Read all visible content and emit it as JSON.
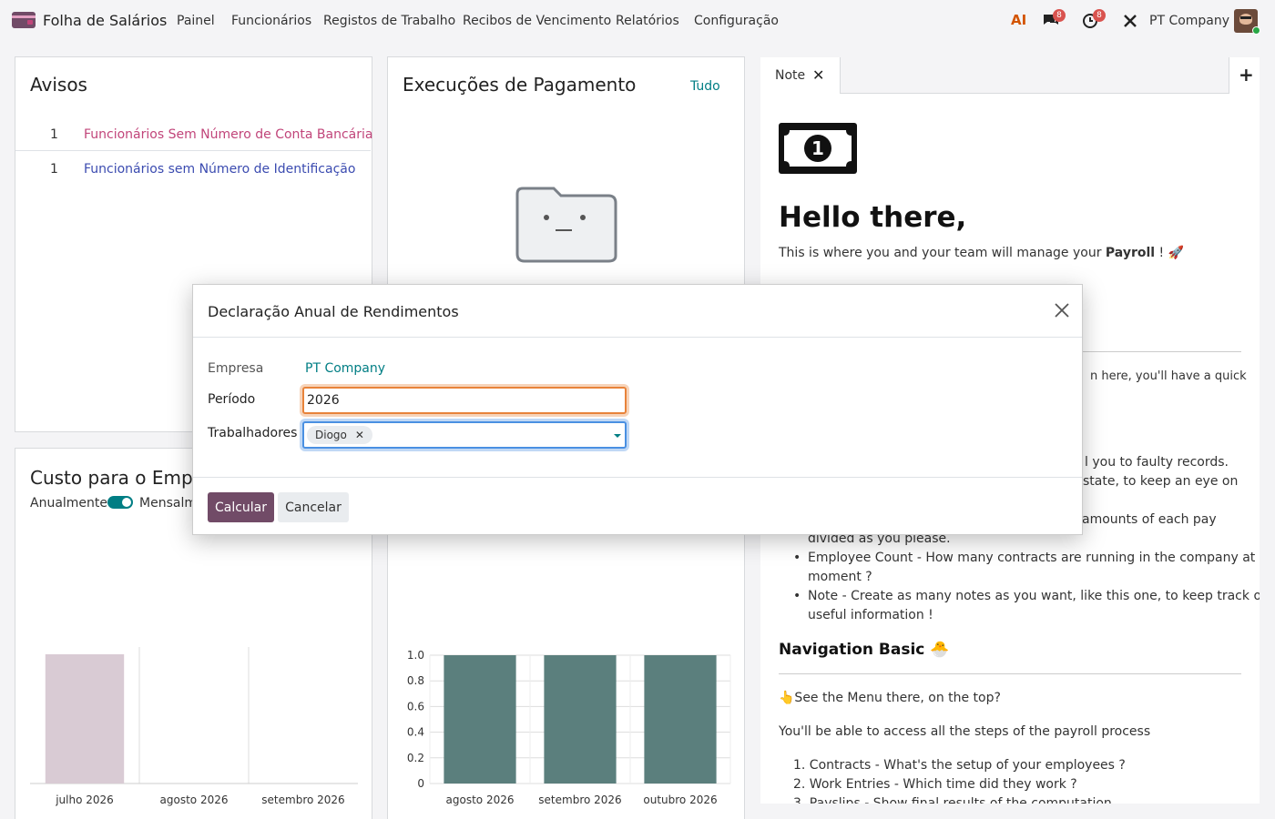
{
  "navbar": {
    "app_name": "Folha de Salários",
    "menu": [
      "Painel",
      "Funcionários",
      "Registos de Trabalho",
      "Recibos de Vencimento",
      "Relatórios",
      "Configuração"
    ],
    "ai_label": "AI",
    "messages_badge": "8",
    "activities_badge": "8",
    "company": "PT Company"
  },
  "warnings": {
    "title": "Avisos",
    "items": [
      {
        "count": "1",
        "label": "Funcionários Sem Número de Conta Bancária",
        "color": "#c1457a"
      },
      {
        "count": "1",
        "label": "Funcionários sem Número de Identificação",
        "color": "#3b4bb0"
      }
    ]
  },
  "payruns": {
    "title": "Execuções de Pagamento",
    "all_link": "Tudo"
  },
  "cost": {
    "title": "Custo para o Empr",
    "toggle_left": "Anualmente",
    "toggle_right": "Mensalm"
  },
  "chart_data": [
    {
      "type": "bar",
      "categories": [
        "julho 2026",
        "agosto 2026",
        "setembro 2026"
      ],
      "values": [
        1,
        0,
        0
      ],
      "colors": [
        "#d9cbd4"
      ]
    },
    {
      "type": "bar",
      "categories": [
        "agosto 2026",
        "setembro 2026",
        "outubro 2026"
      ],
      "values": [
        1.0,
        1.0,
        1.0
      ],
      "ylim": [
        0,
        1.0
      ],
      "yticks": [
        "1.0",
        "0.8",
        "0.6",
        "0.4",
        "0.2",
        "0"
      ],
      "colors": [
        "#5b7f7d"
      ],
      "grid": true
    }
  ],
  "note": {
    "tab_label": "Note",
    "add_label": "+",
    "heading": "Hello there,",
    "intro_pre": "This is where you and your team will manage your ",
    "intro_bold": "Payroll",
    "intro_post": " ! 🚀",
    "partial_1": "n here, you'll have a quick",
    "partial_2": "l you to faulty records.",
    "partial_3": "state, to keep an eye on",
    "partial_4": "amounts of each pay",
    "partial_5": "divided as you please.",
    "bullets": [
      "Employee Count - How many contracts are running in the company at the",
      "moment ?",
      "Note - Create as many notes as you want, like this one, to keep track of all",
      "useful information !"
    ],
    "nav_heading": "Navigation Basic 🐣",
    "menu_hint": "👆See the Menu there, on the top?",
    "access_text": "You'll be able to access all the steps of the payroll process",
    "steps": [
      "1. Contracts - What's the setup of your employees ?",
      "2. Work Entries - Which time did they work ?",
      "3. Payslips - Show final results of the computation"
    ]
  },
  "dialog": {
    "title": "Declaração Anual de Rendimentos",
    "company_label": "Empresa",
    "company_value": "PT Company",
    "period_label": "Período",
    "period_value": "2026",
    "workers_label": "Trabalhadores",
    "worker_tag": "Diogo",
    "calc_button": "Calcular",
    "cancel_button": "Cancelar"
  }
}
